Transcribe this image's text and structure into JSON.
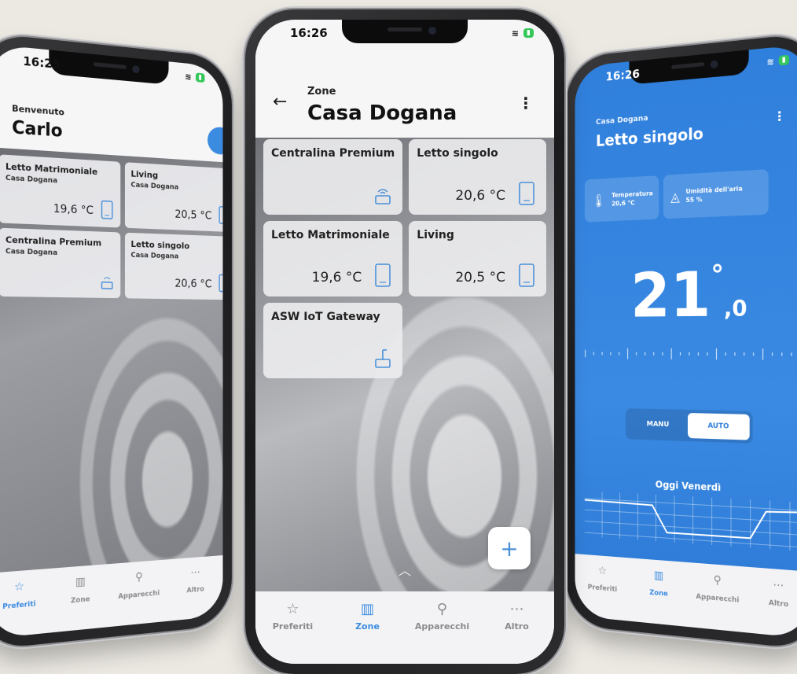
{
  "colors": {
    "accent": "#3b8be0",
    "blue_screen": "#2f7fdc",
    "battery": "#34c759"
  },
  "left": {
    "time": "16:25",
    "welcome": "Benvenuto",
    "user": "Carlo",
    "cards": [
      {
        "name": "Letto Matrimoniale",
        "home": "Casa Dogana",
        "temp": "19,6 °C",
        "icon": "thermostat-icon"
      },
      {
        "name": "Living",
        "home": "Casa Dogana",
        "temp": "20,5 °C",
        "icon": "thermostat-icon"
      },
      {
        "name": "Centralina Premium",
        "home": "Casa Dogana",
        "temp": "",
        "icon": "hub-icon"
      },
      {
        "name": "Letto singolo",
        "home": "Casa Dogana",
        "temp": "20,6 °C",
        "icon": "thermostat-icon"
      }
    ],
    "tabs": [
      "Preferiti",
      "Zone",
      "Apparecchi",
      "Altro"
    ]
  },
  "middle": {
    "time": "16:26",
    "breadcrumb": "Zone",
    "title": "Casa Dogana",
    "cards": [
      {
        "name": "Centralina Premium",
        "temp": "",
        "icon": "hub-icon"
      },
      {
        "name": "Letto singolo",
        "temp": "20,6 °C",
        "icon": "thermostat-icon"
      },
      {
        "name": "Letto Matrimoniale",
        "temp": "19,6 °C",
        "icon": "thermostat-icon"
      },
      {
        "name": "Living",
        "temp": "20,5 °C",
        "icon": "thermostat-icon"
      },
      {
        "name": "ASW IoT Gateway",
        "temp": "",
        "icon": "router-icon"
      }
    ],
    "fab": "+",
    "tabs": [
      "Preferiti",
      "Zone",
      "Apparecchi",
      "Altro"
    ],
    "active_tab": "Zone"
  },
  "right": {
    "time": "16:26",
    "breadcrumb": "Casa Dogana",
    "title": "Letto singolo",
    "chips": [
      {
        "label": "Temperatura",
        "value": "20,6 °C",
        "icon": "thermometer-icon"
      },
      {
        "label": "Umidità dell'aria",
        "value": "55 %",
        "icon": "droplet-icon"
      }
    ],
    "setpoint_int": "21",
    "setpoint_dec": ",0",
    "setpoint_deg": "°",
    "modes": [
      "MANU",
      "AUTO"
    ],
    "active_mode": "AUTO",
    "day": "Oggi Venerdì",
    "tabs": [
      "Preferiti",
      "Zone",
      "Apparecchi",
      "Altro"
    ]
  }
}
